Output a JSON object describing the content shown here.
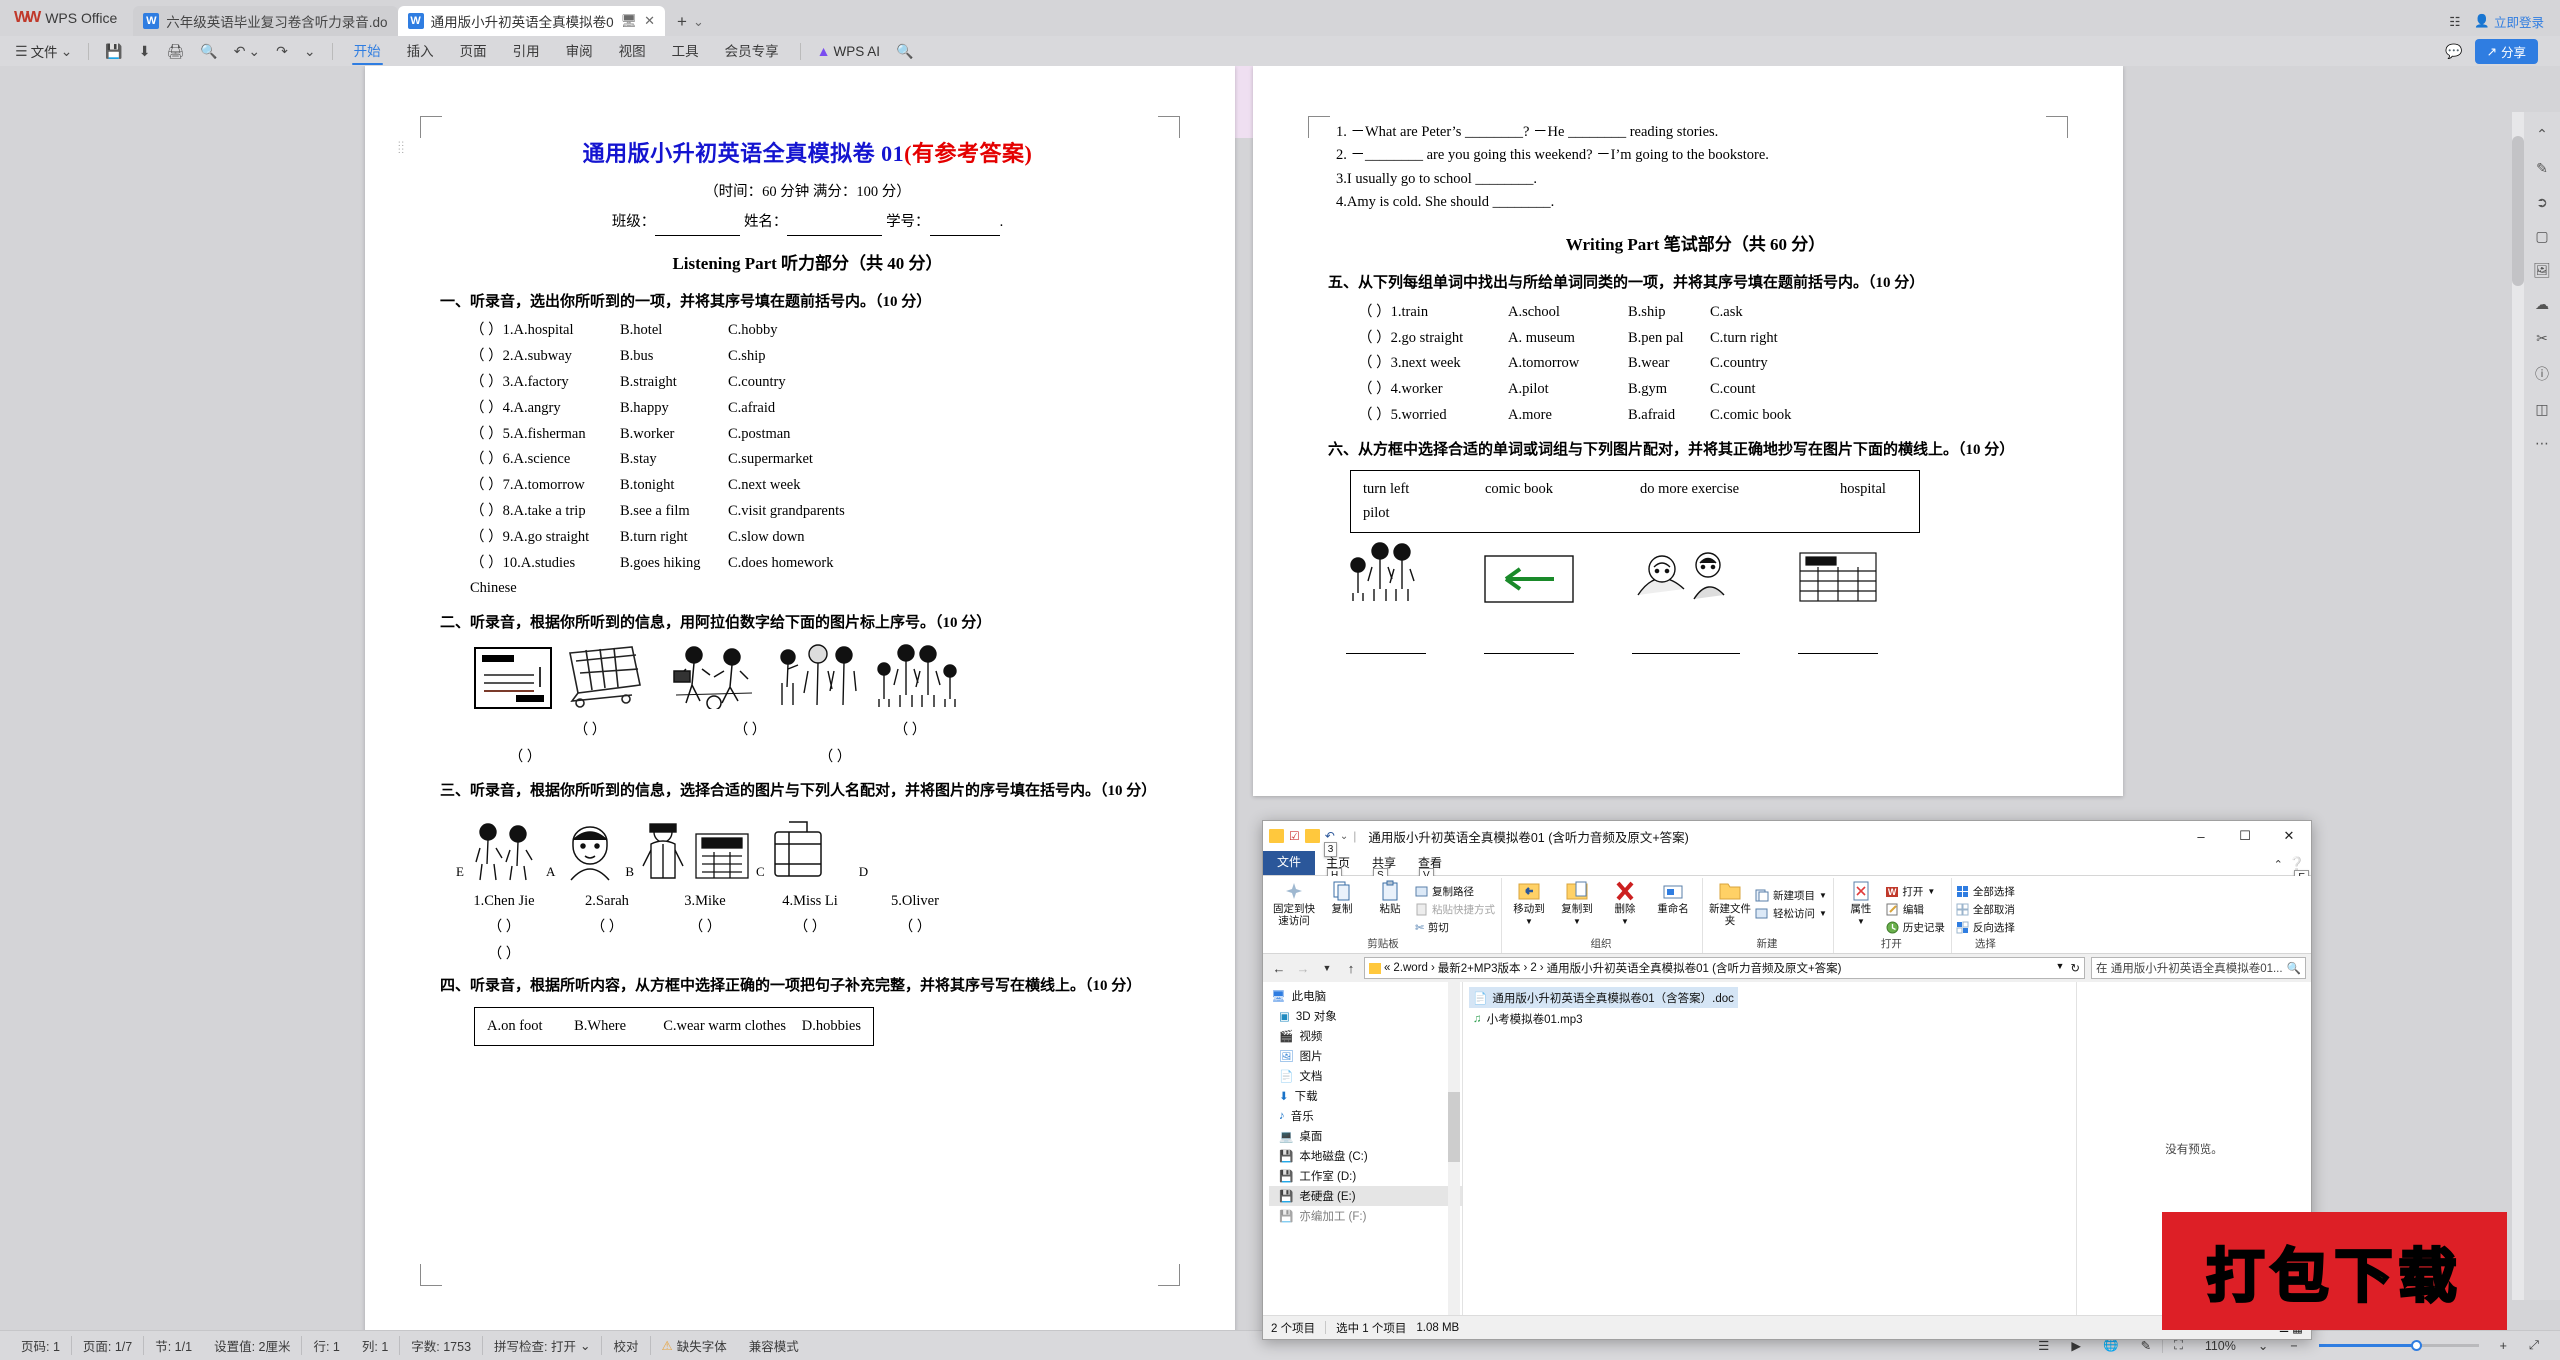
{
  "app": {
    "name": "WPS Office",
    "tabs": [
      {
        "label": "六年级英语毕业复习卷含听力录音.do",
        "active": false,
        "icon": "word-doc-icon"
      },
      {
        "label": "通用版小升初英语全真模拟卷0",
        "active": true,
        "icon": "word-doc-icon"
      }
    ],
    "new_tab": "+",
    "titlebar_right": {
      "layout": "窗口",
      "login": "立即登录"
    }
  },
  "ribbon": {
    "file_menu": "文件",
    "quick_icons": [
      "save-icon",
      "save-as-icon",
      "print-icon",
      "print-preview-icon",
      "undo-icon",
      "redo-icon",
      "customize-icon"
    ],
    "tabs": [
      {
        "label": "开始",
        "active": true
      },
      {
        "label": "插入",
        "active": false
      },
      {
        "label": "页面",
        "active": false
      },
      {
        "label": "引用",
        "active": false
      },
      {
        "label": "审阅",
        "active": false
      },
      {
        "label": "视图",
        "active": false
      },
      {
        "label": "工具",
        "active": false
      },
      {
        "label": "会员专享",
        "active": false
      }
    ],
    "ai_label": "WPS AI",
    "search_icon": "search-icon",
    "share_label": "分享",
    "comment_icon": "comment-icon"
  },
  "document": {
    "title_black": "通用版小升初英语全真模拟卷 01",
    "title_red": "(有参考答案)",
    "subtitle": "（时间：60 分钟  满分：100 分）",
    "id_line": [
      "班级：",
      "姓名：",
      "学号："
    ],
    "listening_heading": "Listening Part  听力部分（共 40 分）",
    "q1_head": "一、听录音，选出你所听到的一项，并将其序号填在题前括号内。（10 分）",
    "q1_items": [
      {
        "num": "（  ）1.",
        "a": "A.hospital",
        "b": "B.hotel",
        "c": "C.hobby"
      },
      {
        "num": "（  ）2.",
        "a": "A.subway",
        "b": "B.bus",
        "c": "C.ship"
      },
      {
        "num": "（  ）3.",
        "a": "A.factory",
        "b": "B.straight",
        "c": "C.country"
      },
      {
        "num": "（  ）4.",
        "a": "A.angry",
        "b": "B.happy",
        "c": "C.afraid"
      },
      {
        "num": "（  ）5.",
        "a": "A.fisherman",
        "b": "B.worker",
        "c": "C.postman"
      },
      {
        "num": "（  ）6.",
        "a": "A.science",
        "b": "B.stay",
        "c": "C.supermarket"
      },
      {
        "num": "（  ）7.",
        "a": "A.tomorrow",
        "b": "B.tonight",
        "c": "C.next week"
      },
      {
        "num": "（  ）8.",
        "a": "A.take a trip",
        "b": "B.see a film",
        "c": "C.visit grandparents"
      },
      {
        "num": "（  ）9.",
        "a": "A.go straight",
        "b": "B.turn right",
        "c": "C.slow down"
      },
      {
        "num": "（  ）10.",
        "a": "A.studies Chinese",
        "b": "B.goes hiking",
        "c": "C.does homework"
      }
    ],
    "q2_head": "二、听录音，根据你所听到的信息，用阿拉伯数字给下面的图片标上序号。（10 分）",
    "q2_answer_parens": [
      "（        ）",
      "（        ）",
      "（        ）"
    ],
    "q2_answer_parens2": [
      "（        ）",
      "（        ）"
    ],
    "q3_head": "三、听录音，根据你所听到的信息，选择合适的图片与下列人名配对，并将图片的序号填在括号内。（10 分）",
    "q3_letters": [
      "A",
      "B",
      "C",
      "D",
      "E"
    ],
    "q3_names": [
      "1.Chen Jie",
      "2.Sarah",
      "3.Mike",
      "4.Miss Li",
      "5.Oliver"
    ],
    "q3_parens": [
      "（        ）",
      "（        ）",
      "（        ）",
      "（        ）",
      "（        ）"
    ],
    "q4_head": "四、听录音，根据所听内容，从方框中选择正确的一项把句子补充完整，并将其序号写在横线上。（10 分）",
    "q4_box": [
      "A.on foot",
      "B.Where",
      "C.wear warm clothes",
      "D.hobbies"
    ],
    "right_sentences": [
      "1. －What are Peter’s ________?                －He  ________ reading stories.",
      "2. －________ are you going this weekend?        －I’m going to the bookstore.",
      "3.I usually go to school ________.",
      "4.Amy is cold. She should ________."
    ],
    "writing_heading": "Writing Part  笔试部分（共 60 分）",
    "q5_head": "五、从下列每组单词中找出与所给单词同类的一项，并将其序号填在题前括号内。（10 分）",
    "q5_items": [
      {
        "num": "（  ）1.",
        "word": "train",
        "a": "A.school",
        "b": "B.ship",
        "c": "C.ask"
      },
      {
        "num": "（  ）2.",
        "word": "go straight",
        "a": "A. museum",
        "b": "B.pen pal",
        "c": "C.turn right"
      },
      {
        "num": "（  ）3.",
        "word": "next week",
        "a": "A.tomorrow",
        "b": "B.wear",
        "c": "C.country"
      },
      {
        "num": "（  ）4.",
        "word": "worker",
        "a": "A.pilot",
        "b": "B.gym",
        "c": "C.count"
      },
      {
        "num": "（  ）5.",
        "word": "worried",
        "a": "A.more",
        "b": "B.afraid",
        "c": "C.comic book"
      }
    ],
    "q6_head": "六、从方框中选择合适的单词或词组与下列图片配对，并将其正确地抄写在图片下面的横线上。（10 分）",
    "q6_box_row1": [
      "turn  left",
      "comic  book",
      "do  more  exercise",
      "hospital"
    ],
    "q6_box_row2": [
      "pilot"
    ]
  },
  "explorer": {
    "title": "通用版小升初英语全真模拟卷01 (含听力音频及原文+答案)",
    "window_buttons": [
      "minimize-icon",
      "maximize-icon",
      "close-icon"
    ],
    "tabs": [
      {
        "label": "文件",
        "keytip": ""
      },
      {
        "label": "主页",
        "keytip": "H"
      },
      {
        "label": "共享",
        "keytip": "S"
      },
      {
        "label": "查看",
        "keytip": "V"
      }
    ],
    "quick_access_keytip": "3",
    "help_keytip": "E",
    "groups": [
      {
        "name": "剪贴板",
        "big": [
          {
            "label": "固定到快速访问",
            "icon": "pin-icon"
          },
          {
            "label": "复制",
            "icon": "copy-icon"
          },
          {
            "label": "粘贴",
            "icon": "paste-icon"
          }
        ],
        "small": [
          {
            "label": "复制路径",
            "icon": "copy-path-icon",
            "dim": false
          },
          {
            "label": "粘贴快捷方式",
            "icon": "paste-shortcut-icon",
            "dim": true
          },
          {
            "label": "剪切",
            "icon": "scissors-icon",
            "dim": false
          }
        ]
      },
      {
        "name": "组织",
        "big": [
          {
            "label": "移动到",
            "icon": "move-to-icon"
          },
          {
            "label": "复制到",
            "icon": "copy-to-icon"
          },
          {
            "label": "删除",
            "icon": "delete-icon"
          },
          {
            "label": "重命名",
            "icon": "rename-icon"
          }
        ],
        "small": []
      },
      {
        "name": "新建",
        "big": [
          {
            "label": "新建文件夹",
            "icon": "new-folder-icon"
          }
        ],
        "small": [
          {
            "label": "新建项目",
            "icon": "new-item-icon",
            "dim": false
          },
          {
            "label": "轻松访问",
            "icon": "easy-access-icon",
            "dim": false
          }
        ]
      },
      {
        "name": "打开",
        "big": [
          {
            "label": "属性",
            "icon": "properties-icon"
          }
        ],
        "small": [
          {
            "label": "打开",
            "icon": "open-word-icon",
            "dim": false
          },
          {
            "label": "编辑",
            "icon": "edit-icon",
            "dim": false
          },
          {
            "label": "历史记录",
            "icon": "history-icon",
            "dim": false
          }
        ]
      },
      {
        "name": "选择",
        "big": [],
        "small": [
          {
            "label": "全部选择",
            "icon": "select-all-icon",
            "dim": false
          },
          {
            "label": "全部取消",
            "icon": "select-none-icon",
            "dim": false
          },
          {
            "label": "反向选择",
            "icon": "invert-selection-icon",
            "dim": false
          }
        ]
      }
    ],
    "breadcrumb": [
      "2.word",
      "最新2+MP3版本",
      "2",
      "通用版小升初英语全真模拟卷01 (含听力音频及原文+答案)"
    ],
    "search_placeholder": "在 通用版小升初英语全真模拟卷01...",
    "nav_items": [
      {
        "label": "此电脑",
        "icon": "this-pc-icon",
        "selected": false
      },
      {
        "label": "3D 对象",
        "icon": "3d-objects-icon",
        "selected": false
      },
      {
        "label": "视频",
        "icon": "videos-icon",
        "selected": false
      },
      {
        "label": "图片",
        "icon": "pictures-icon",
        "selected": false
      },
      {
        "label": "文档",
        "icon": "documents-icon",
        "selected": false
      },
      {
        "label": "下载",
        "icon": "downloads-icon",
        "selected": false
      },
      {
        "label": "音乐",
        "icon": "music-icon",
        "selected": false
      },
      {
        "label": "桌面",
        "icon": "desktop-icon",
        "selected": false
      },
      {
        "label": "本地磁盘 (C:)",
        "icon": "drive-icon",
        "selected": false
      },
      {
        "label": "工作室 (D:)",
        "icon": "drive-icon",
        "selected": false
      },
      {
        "label": "老硬盘 (E:)",
        "icon": "drive-icon",
        "selected": true
      },
      {
        "label": "亦编加工 (F:)",
        "icon": "drive-icon",
        "selected": false
      }
    ],
    "files": [
      {
        "name": "通用版小升初英语全真模拟卷01（含答案）.doc",
        "icon": "word-file-icon",
        "selected": true
      },
      {
        "name": "小考模拟卷01.mp3",
        "icon": "mp3-file-icon",
        "selected": false
      }
    ],
    "preview_text": "没有预览。",
    "status": {
      "count": "2 个项目",
      "selected": "选中 1 个项目",
      "size": "1.08 MB"
    }
  },
  "watermark": {
    "text": "打包下载",
    "bg": "#dd1f26",
    "fg": "#ffec00"
  },
  "statusbar": {
    "items": [
      "页码: 1",
      "页面: 1/7",
      "节: 1/1",
      "设置值: 2厘米",
      "行: 1",
      "列: 1",
      "字数: 1753",
      "拼写检查: 打开",
      "校对",
      "缺失字体",
      "兼容模式"
    ],
    "zoom": "110%",
    "view_icons": [
      "outline-view-icon",
      "read-view-icon",
      "web-view-icon",
      "pen-icon",
      "fullpage-icon"
    ],
    "zoom_out": "−",
    "zoom_in": "+",
    "fit_icon": "fit-screen-icon"
  },
  "rail_icons": [
    "cursor-icon",
    "highlighter-icon",
    "shape-icon",
    "image-icon",
    "cloud-icon",
    "scissors-icon",
    "help-icon",
    "layers-icon",
    "more-icon"
  ],
  "colors": {
    "accent": "#2f7de1",
    "title_blue": "#1414d0",
    "title_red": "#e40000",
    "stamp_red": "#dd1f26"
  }
}
